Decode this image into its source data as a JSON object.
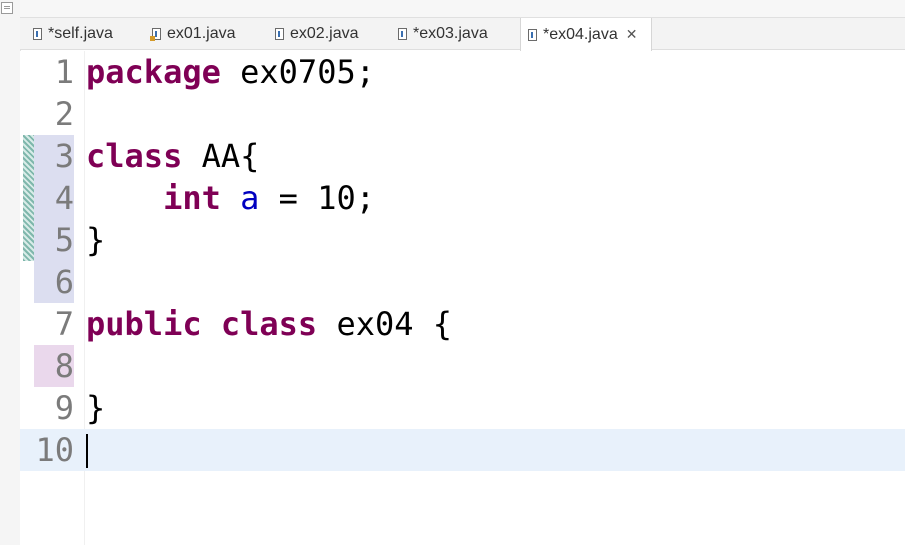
{
  "tabs": [
    {
      "label": "*self.java",
      "active": false
    },
    {
      "label": "ex01.java",
      "active": false
    },
    {
      "label": "ex02.java",
      "active": false
    },
    {
      "label": "*ex03.java",
      "active": false
    },
    {
      "label": "*ex04.java",
      "active": true
    }
  ],
  "editor": {
    "lines": [
      {
        "num": "1",
        "tokens": [
          {
            "t": "package",
            "c": "kw"
          },
          {
            "t": " ex0705;",
            "c": ""
          }
        ]
      },
      {
        "num": "2",
        "tokens": []
      },
      {
        "num": "3",
        "tokens": [
          {
            "t": "class",
            "c": "kw"
          },
          {
            "t": " AA{",
            "c": ""
          }
        ]
      },
      {
        "num": "4",
        "tokens": [
          {
            "t": "    ",
            "c": ""
          },
          {
            "t": "int",
            "c": "kw"
          },
          {
            "t": " ",
            "c": ""
          },
          {
            "t": "a",
            "c": "field"
          },
          {
            "t": " = 10;",
            "c": ""
          }
        ]
      },
      {
        "num": "5",
        "tokens": [
          {
            "t": "}",
            "c": ""
          }
        ]
      },
      {
        "num": "6",
        "tokens": []
      },
      {
        "num": "7",
        "tokens": [
          {
            "t": "public",
            "c": "kw"
          },
          {
            "t": " ",
            "c": ""
          },
          {
            "t": "class",
            "c": "kw"
          },
          {
            "t": " ex04 {",
            "c": ""
          }
        ]
      },
      {
        "num": "8",
        "tokens": []
      },
      {
        "num": "9",
        "tokens": [
          {
            "t": "}",
            "c": ""
          }
        ]
      },
      {
        "num": "10",
        "tokens": []
      }
    ],
    "current_line": "10"
  },
  "colors": {
    "keyword": "#7f0055",
    "field": "#0000c0",
    "current_line": "#e8f1fb"
  }
}
